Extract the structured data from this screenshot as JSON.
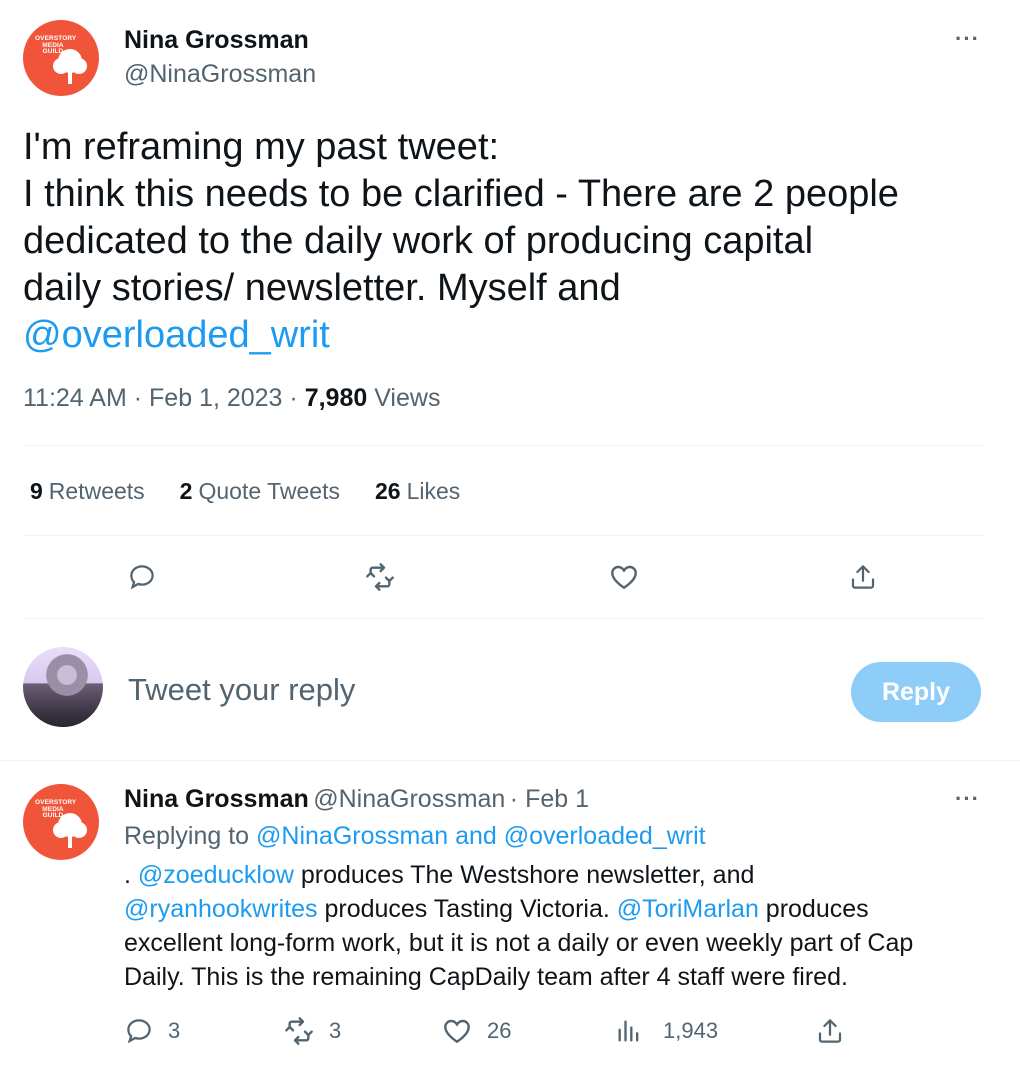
{
  "main_tweet": {
    "author_name": "Nina Grossman",
    "author_handle": "@NinaGrossman",
    "avatar_text": "OVERSTORY MEDIA GUILD",
    "text_lines": [
      "I'm reframing my past tweet:",
      "I think this needs to be clarified - There are 2 people",
      "dedicated to the daily work of producing capital",
      "daily stories/ newsletter. Myself and"
    ],
    "mention": "@overloaded_writ",
    "time": "11:24 AM",
    "date": "Feb 1, 2023",
    "views_count": "7,980",
    "views_label": "Views",
    "retweets_count": "9",
    "retweets_label": "Retweets",
    "quotes_count": "2",
    "quotes_label": "Quote Tweets",
    "likes_count": "26",
    "likes_label": "Likes",
    "more_label": "···"
  },
  "compose": {
    "placeholder": "Tweet your reply",
    "button_label": "Reply"
  },
  "reply_tweet": {
    "author_name": "Nina Grossman",
    "author_handle": "@NinaGrossman",
    "date": "· Feb 1",
    "replying_prefix": "Replying to",
    "replying_to": "@NinaGrossman and @overloaded_writ",
    "line1_pre": ". ",
    "line1_mention": "@zoeducklow",
    "line1_post": " produces The Westshore newsletter, and",
    "line2_mention": "@ryanhookwrites",
    "line2_mid": " produces Tasting Victoria. ",
    "line2_mention2": "@ToriMarlan",
    "line2_post": " produces",
    "line3": "excellent long-form work, but it is not a daily or even weekly part of Cap",
    "line4": "Daily.  This is the remaining CapDaily team after 4 staff were fired.",
    "replies": "3",
    "retweets": "3",
    "likes": "26",
    "views": "1,943",
    "more_label": "···"
  },
  "colors": {
    "accent": "#1d9bf0",
    "secondary_text": "#536471",
    "avatar_bg": "#f0553a"
  }
}
